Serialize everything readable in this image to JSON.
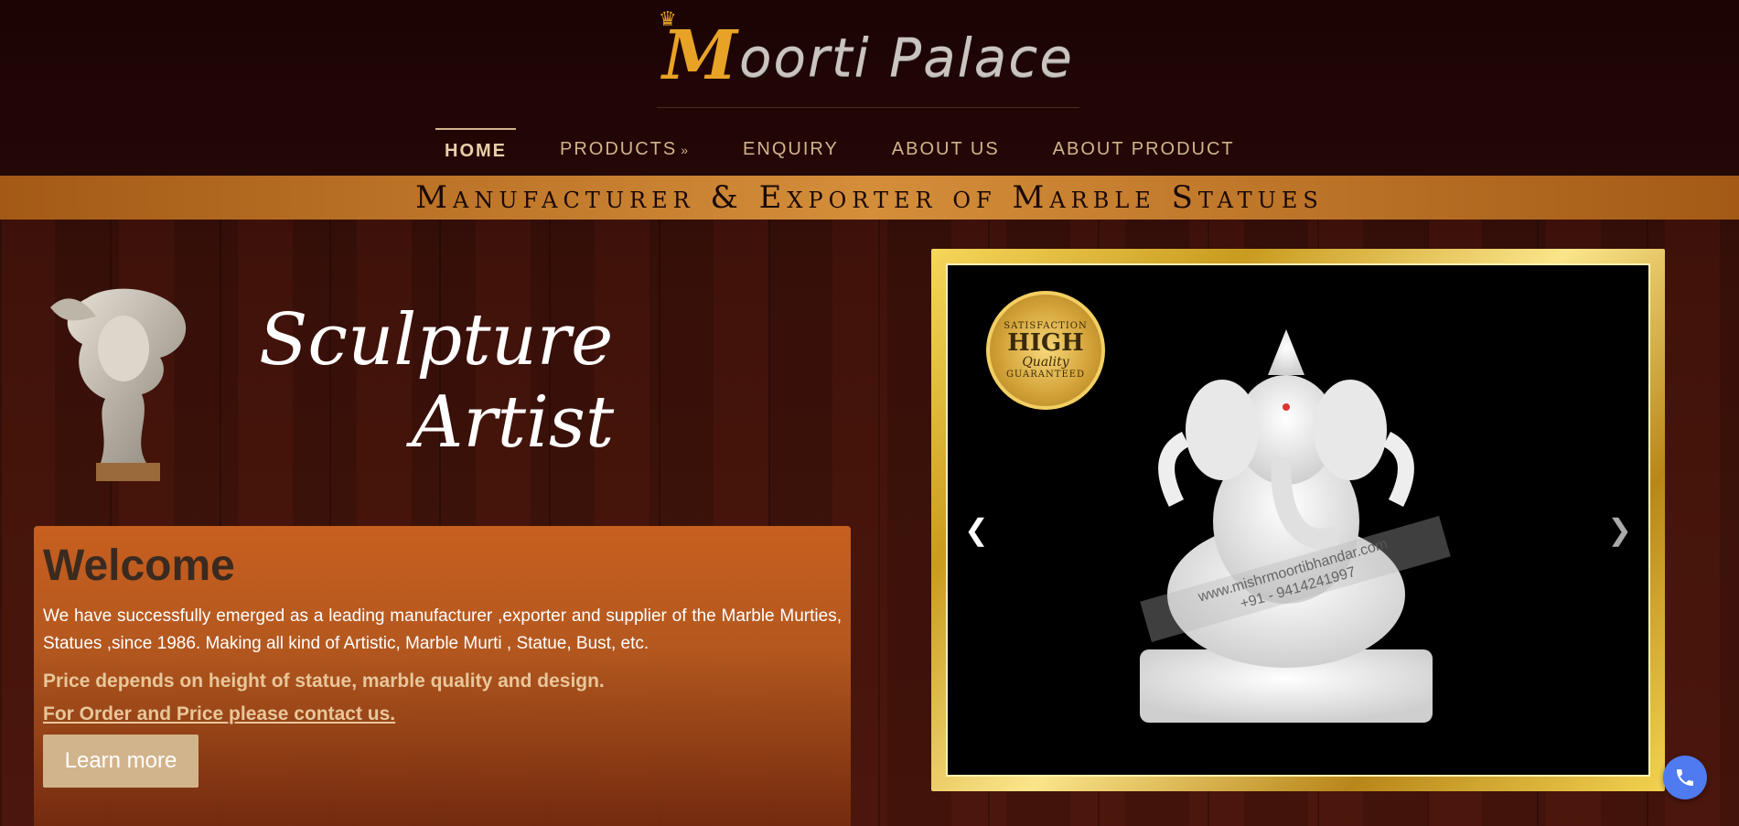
{
  "header": {
    "logo": {
      "initial": "M",
      "text": "oorti Palace"
    },
    "nav": [
      {
        "label": "HOME",
        "active": true
      },
      {
        "label": "PRODUCTS",
        "dropdown": true
      },
      {
        "label": "ENQUIRY"
      },
      {
        "label": "ABOUT US"
      },
      {
        "label": "ABOUT PRODUCT"
      }
    ],
    "banner": "Manufacturer & Exporter of Marble Statues"
  },
  "hero": {
    "line1": "Sculpture",
    "line2": "Artist"
  },
  "welcome": {
    "title": "Welcome",
    "paragraph": "We have successfully emerged as a leading manufacturer ,exporter and supplier of the Marble Murties, Statues ,since 1986. Making all kind of Artistic, Marble Murti , Statue, Bust, etc.",
    "price_note": "Price depends on height of statue, marble quality and design.",
    "contact_link": "For Order and Price please contact us.",
    "button": "Learn more"
  },
  "carousel": {
    "badge": {
      "top": "SATISFACTION",
      "big": "HIGH",
      "sub": "Quality",
      "bottom": "GUARANTEED"
    },
    "watermark_line1": "www.mishrmoortibhandar.com",
    "watermark_line2": "+91 - 9414241997",
    "prev_icon": "chevron-left-icon",
    "next_icon": "chevron-right-icon"
  },
  "colors": {
    "header_bg": "#1c0404",
    "banner": "#d48e3a",
    "nav_text": "#d2b48c",
    "welcome_bg": "#c75f1f",
    "button_bg": "#d2b48c",
    "fab": "#4f7af0"
  }
}
